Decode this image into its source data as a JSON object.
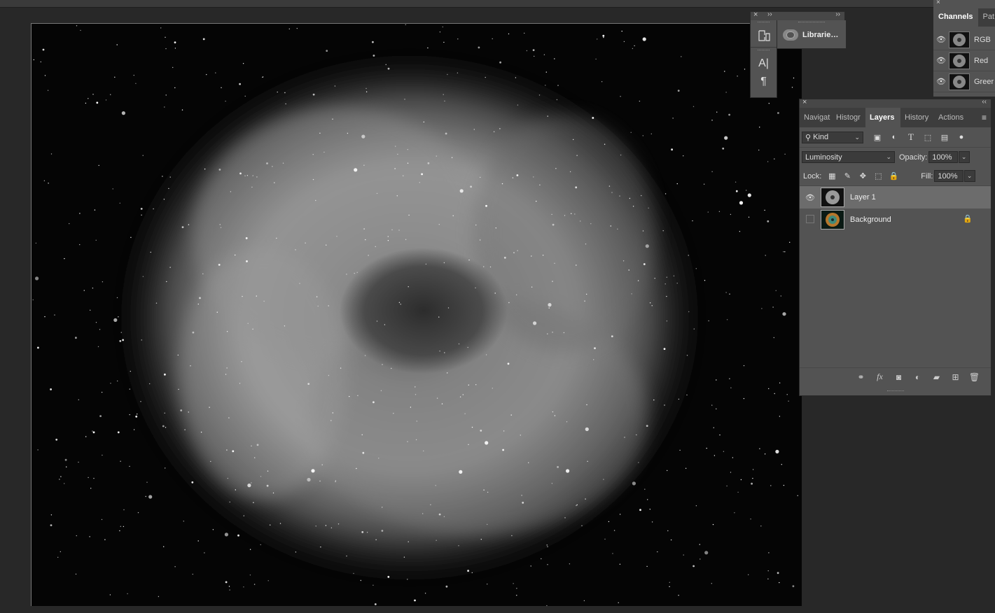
{
  "floating_panel": {
    "library_label": "Librarie…",
    "tool_icons": [
      "glyph-tool-icon",
      "character-icon",
      "paragraph-icon"
    ]
  },
  "channels_panel": {
    "tabs": [
      "Channels",
      "Pat"
    ],
    "rows": [
      {
        "name": "RGB"
      },
      {
        "name": "Red"
      },
      {
        "name": "Greer"
      }
    ]
  },
  "layers_panel": {
    "tabs": [
      "Navigat",
      "Histogr",
      "Layers",
      "History",
      "Actions"
    ],
    "active_tab": "Layers",
    "filter": {
      "kind_label": "Kind"
    },
    "blend_mode": "Luminosity",
    "opacity_label": "Opacity:",
    "opacity_value": "100%",
    "lock_label": "Lock:",
    "fill_label": "Fill:",
    "fill_value": "100%",
    "layers": [
      {
        "name": "Layer 1",
        "visible": true,
        "selected": true
      },
      {
        "name": "Background",
        "visible": false,
        "locked": true
      }
    ]
  },
  "colors": {
    "panel_bg": "#535353",
    "tab_bar_bg": "#3d3d3d",
    "workspace_bg": "#282828",
    "selected_row": "#6c6c6c"
  }
}
